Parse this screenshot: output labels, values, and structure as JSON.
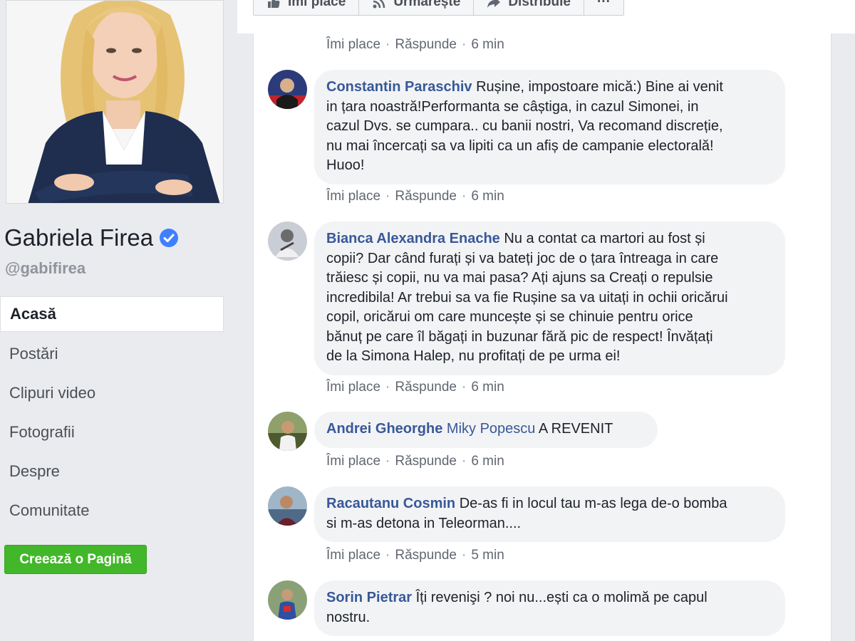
{
  "profile": {
    "name": "Gabriela Firea",
    "handle": "@gabifirea"
  },
  "nav": {
    "items": [
      "Acasă",
      "Postări",
      "Clipuri video",
      "Fotografii",
      "Despre",
      "Comunitate"
    ],
    "active": "Acasă"
  },
  "create_page_label": "Creează o Pagină",
  "post_actions": {
    "like": "Îmi place",
    "follow": "Urmărește",
    "share": "Distribuie",
    "more": "···"
  },
  "comment_actions": {
    "like": "Îmi place",
    "reply": "Răspunde"
  },
  "top_comment_time": "6 min",
  "comments": [
    {
      "author": "Constantin Paraschiv",
      "lines": [
        " Rușine, impostoare mică:) Bine ai venit",
        "in țara noastră!Performanta se câștiga, in cazul Simonei, in",
        "cazul Dvs. se cumpara.. cu banii nostri, Va recomand discreție,",
        "nu mai încercați sa va lipiti ca un afiș de campanie electorală!",
        "Huoo!"
      ],
      "time": "6 min"
    },
    {
      "author": "Bianca Alexandra Enache",
      "lines": [
        " Nu a contat ca martori au fost și",
        "copii? Dar când furați și va bateți joc de o țara întreaga in care",
        "trăiesc și copii, nu va mai pasa? Ați ajuns sa Creați o repulsie",
        "incredibila! Ar trebui sa va fie Rușine sa va uitați in ochii oricărui",
        "copil, oricărui om care muncește și se chinuie pentru orice",
        "bănuț pe care îl băgați in buzunar fără pic de respect! Învățați",
        "de la Simona Halep, nu profitați de pe urma ei!"
      ],
      "time": "6 min"
    },
    {
      "author": "Andrei Gheorghe",
      "mention": "Miky Popescu",
      "lines": [
        " A REVENIT"
      ],
      "time": "6 min"
    },
    {
      "author": "Racautanu Cosmin",
      "lines": [
        " De-as fi in locul tau m-as lega de-o bomba",
        "si m-as detona in Teleorman...."
      ],
      "time": "5 min"
    },
    {
      "author": "Sorin Pietrar",
      "lines": [
        " Îți revenişi ? noi nu...ești ca o molimă pe capul",
        "nostru."
      ]
    }
  ],
  "colors": {
    "link": "#385898",
    "bubble": "#f2f3f5",
    "background": "#e9ebee",
    "green_button": "#42b72a",
    "verified": "#4080ff"
  }
}
